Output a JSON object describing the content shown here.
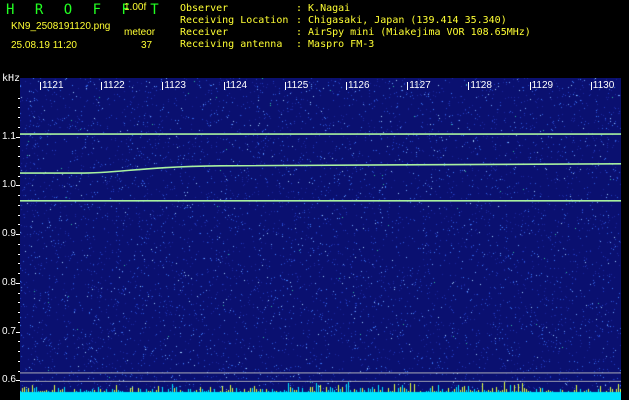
{
  "header": {
    "app_title": "H R O F F T",
    "version": "1.00f",
    "filename": "KN9_2508191120.png",
    "datetime": "25.08.19 11:20",
    "count_label": "meteor",
    "count_value": "37"
  },
  "info": [
    {
      "label": "Observer",
      "value": ": K.Nagai"
    },
    {
      "label": "Receiving Location",
      "value": ": Chigasaki, Japan (139.414 35.340)"
    },
    {
      "label": "Receiver",
      "value": ": AirSpy mini (Miakejima VOR 108.65MHz)"
    },
    {
      "label": "Receiving antenna",
      "value": ": Maspro FM-3"
    }
  ],
  "colors": {
    "text_green": "#22ff22",
    "text_yellow": "#ffff33",
    "background": "#000000",
    "spectrogram_base": "#0a1070",
    "noise_bright": "#4080ff",
    "signal": "#a8f0a0",
    "baseline_cyan": "#00e8ff"
  },
  "chart_data": {
    "type": "heatmap",
    "title": "",
    "ylabel": "kHz",
    "xlabel": "",
    "x_ticks": [
      "1121",
      "1122",
      "1123",
      "1124",
      "1125",
      "1126",
      "1127",
      "1128",
      "1129",
      "1130"
    ],
    "y_ticks": [
      "1.1",
      "1.0",
      "0.9",
      "0.8",
      "0.7",
      "0.6"
    ],
    "ylim": [
      0.58,
      1.22
    ],
    "signals": [
      {
        "name": "",
        "freq_start": 1.105,
        "freq_end": 1.105
      },
      {
        "name": "",
        "freq_start": 1.025,
        "freq_end": 1.044
      },
      {
        "name": "",
        "freq_start": 0.968,
        "freq_end": 0.968
      }
    ]
  }
}
